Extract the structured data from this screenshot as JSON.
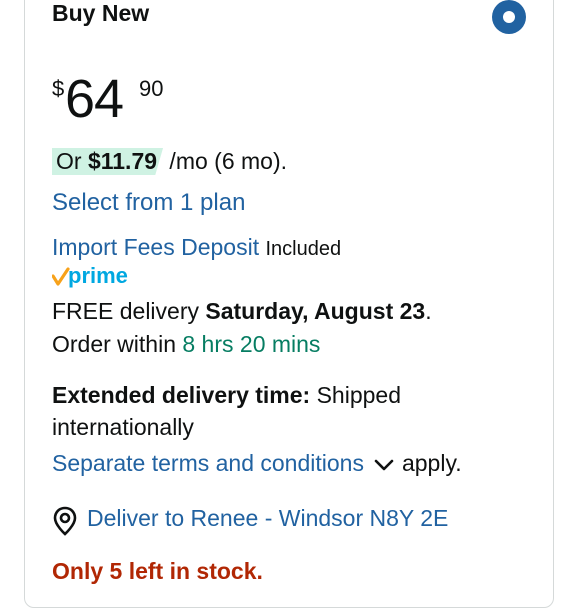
{
  "offer": {
    "title": "Buy New",
    "radio_selected": true
  },
  "price": {
    "symbol": "$",
    "whole": "64",
    "fraction": "90"
  },
  "installment": {
    "prefix": "Or ",
    "amount": "$11.79",
    "suffix": " /mo (6 mo)."
  },
  "plan_link": "Select from 1 plan",
  "import_fees": {
    "link": "Import Fees Deposit",
    "status": "Included"
  },
  "prime": {
    "label": "prime"
  },
  "delivery": {
    "prefix": "FREE delivery ",
    "date": "Saturday, August 23",
    "date_suffix": ".",
    "order_prefix": "Order within ",
    "countdown": "8 hrs 20 mins"
  },
  "extended": {
    "label": "Extended delivery time:",
    "text1": " Shipped",
    "text2": "internationally",
    "terms_link": "Separate terms and conditions",
    "terms_suffix": "apply."
  },
  "location": {
    "text": "Deliver to Renee - Windsor N8Y 2E"
  },
  "stock": {
    "text": "Only 5 left in stock."
  },
  "colors": {
    "link": "#2162a1",
    "green": "#067d62",
    "highlight": "#cff2e3",
    "stock": "#b12704",
    "prime": "#00a8e1"
  }
}
